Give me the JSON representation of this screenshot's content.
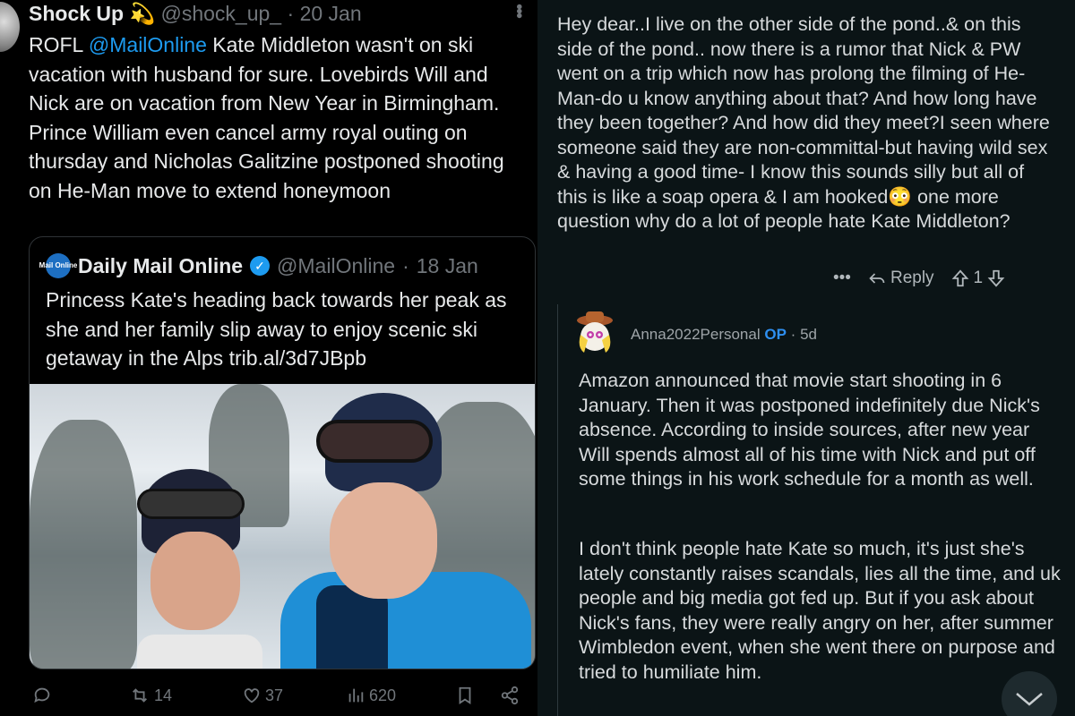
{
  "tweet": {
    "author_name": "Shock Up",
    "author_emoji": "💫",
    "handle": "@shock_up_",
    "date": "20 Jan",
    "text_prefix": "ROFL ",
    "mention": "@MailOnline",
    "text_body": " Kate Middleton wasn't on ski vacation with husband for sure. Lovebirds Will and Nick are on vacation from New Year in Birmingham. Prince William even cancel army royal outing on thursday and Nicholas Galitzine postponed shooting on He-Man move to extend honeymoon",
    "quote": {
      "logo_text": "Mail Online",
      "author_name": "Daily Mail Online",
      "handle": "@MailOnline",
      "date": "18 Jan",
      "text": "Princess Kate's heading back towards her peak as she and her family slip away to enjoy scenic ski getaway in the Alps trib.al/3d7JBpb"
    },
    "actions": {
      "reposts": "14",
      "likes": "37",
      "views": "620"
    }
  },
  "reddit": {
    "parent_comment": "Hey dear..I live on the other side of the pond..& on this side of the pond.. now there is a rumor that Nick & PW went on a trip which now has prolong the filming of He-Man-do u know anything about that? And how long have they been together? And how did they meet?I seen where someone said they are non-committal-but having wild sex & having a good time- I know this sounds silly but all of this is like a soap opera & I am hooked😳 one more question why do a lot of people hate Kate Middleton?",
    "parent_actions": {
      "more": "•••",
      "reply": "Reply",
      "votes": "1"
    },
    "reply": {
      "username": "Anna2022Personal",
      "op_badge": "OP",
      "age": "5d",
      "paragraph1": "Amazon announced that movie start shooting in 6 January. Then it was postponed indefinitely due Nick's absence. According to inside sources, after new year Will spends almost all of his time with Nick and put off some things in his work schedule for a month as well.",
      "paragraph2": "I don't think people hate Kate so much, it's just she's lately constantly raises scandals, lies all the time, and uk people and big media got fed up. But if you ask about Nick's fans, they were really angry on her, after summer Wimbledon event, when she went there on purpose and tried to humiliate him."
    }
  },
  "colors": {
    "twitter_bg": "#000000",
    "reddit_bg": "#0b1416",
    "link_blue": "#1d9bf0",
    "op_blue": "#2e8ff0",
    "muted": "#71767b"
  },
  "icons": [
    "reply-icon",
    "repost-icon",
    "like-icon",
    "views-icon",
    "bookmark-icon",
    "share-icon",
    "more-icon",
    "verified-icon",
    "upvote-icon",
    "downvote-icon",
    "scroll-down-icon"
  ]
}
